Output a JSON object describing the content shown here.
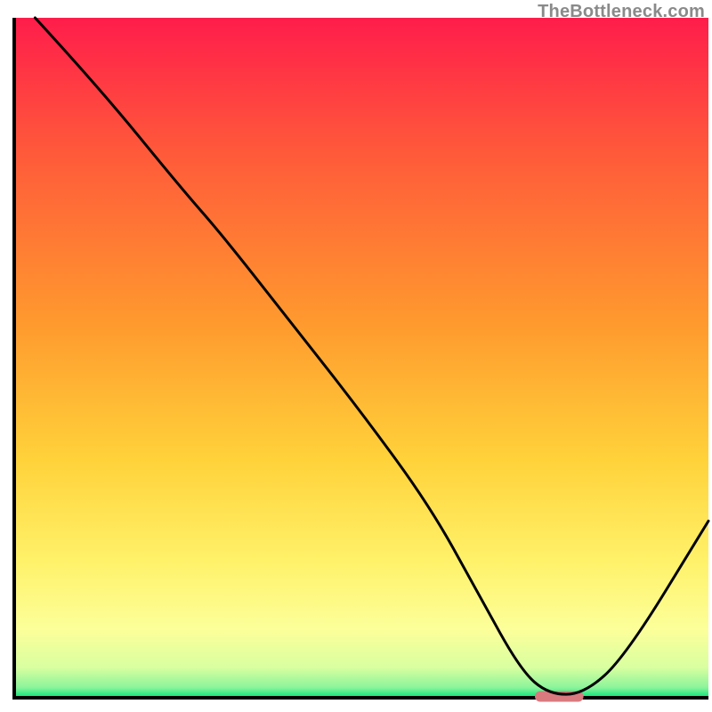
{
  "watermark": "TheBottleneck.com",
  "chart_data": {
    "type": "line",
    "title": "",
    "xlabel": "",
    "ylabel": "",
    "xlim": [
      0,
      100
    ],
    "ylim": [
      0,
      100
    ],
    "grid": false,
    "legend": false,
    "series": [
      {
        "name": "curve",
        "x": [
          3,
          12,
          24,
          30,
          40,
          50,
          60,
          67,
          73,
          77,
          82,
          88,
          100
        ],
        "y": [
          100,
          90,
          75,
          68,
          55,
          42,
          28,
          15,
          4,
          0.5,
          0.5,
          6,
          26
        ]
      }
    ],
    "marker": {
      "name": "optimum-marker",
      "x_start": 75,
      "x_end": 82,
      "y": 0.2,
      "color": "#d97a7f"
    },
    "gradient_stops": [
      {
        "offset": 0.0,
        "color": "#ff1d4b"
      },
      {
        "offset": 0.2,
        "color": "#ff5a3a"
      },
      {
        "offset": 0.45,
        "color": "#ff9a2e"
      },
      {
        "offset": 0.65,
        "color": "#ffd23a"
      },
      {
        "offset": 0.8,
        "color": "#fff26a"
      },
      {
        "offset": 0.9,
        "color": "#fcff9a"
      },
      {
        "offset": 0.955,
        "color": "#d9ffa0"
      },
      {
        "offset": 0.985,
        "color": "#8cf49a"
      },
      {
        "offset": 1.0,
        "color": "#00e676"
      }
    ],
    "axis_color": "#000000",
    "curve_color": "#000000",
    "curve_width": 3
  }
}
